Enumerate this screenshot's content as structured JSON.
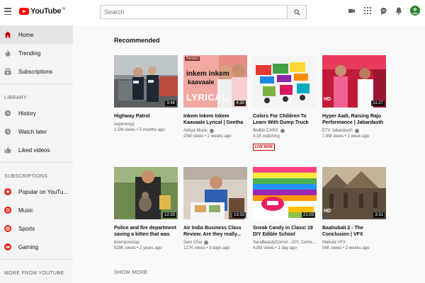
{
  "header": {
    "logo_text": "YouTube",
    "logo_sup": "IN",
    "search_placeholder": "Search"
  },
  "sidebar": {
    "main_items": [
      {
        "label": "Home",
        "icon": "home-icon"
      },
      {
        "label": "Trending",
        "icon": "flame-icon"
      },
      {
        "label": "Subscriptions",
        "icon": "subscriptions-icon"
      }
    ],
    "library_title": "LIBRARY",
    "library_items": [
      {
        "label": "History",
        "icon": "history-icon"
      },
      {
        "label": "Watch later",
        "icon": "clock-icon"
      },
      {
        "label": "Liked videos",
        "icon": "thumbs-up-icon"
      }
    ],
    "subscriptions_title": "SUBSCRIPTIONS",
    "subscription_items": [
      {
        "label": "Popular on YouTu...",
        "icon": "star-channel-icon"
      },
      {
        "label": "Music",
        "icon": "music-channel-icon"
      },
      {
        "label": "Sports",
        "icon": "sports-channel-icon"
      },
      {
        "label": "Gaming",
        "icon": "gaming-channel-icon"
      }
    ],
    "more_title": "MORE FROM YOUTUBE"
  },
  "main": {
    "section_title": "Recommended",
    "show_more": "SHOW MORE",
    "videos": [
      {
        "title": "Highway Patrol",
        "channel": "superwog1",
        "verified": true,
        "meta": "1.5M views • 5 months ago",
        "duration": "3:48",
        "live": ""
      },
      {
        "title": "Inkem Inkem Inkem Kaavaale Lyrical | Geetha Govindam...",
        "channel": "Aditya Music",
        "verified": true,
        "meta": "25M views • 2 weeks ago",
        "duration": "4:30",
        "live": ""
      },
      {
        "title": "Colors For Children To Learn With Dump Truck Toys #w -...",
        "channel": "BinBin CARS",
        "verified": true,
        "meta": "4.1K watching",
        "duration": "",
        "live": "LIVE NOW"
      },
      {
        "title": "Hyper Aadi, Raising Raju Performance | Jabardasth |...",
        "channel": "ETV Jabardasth",
        "verified": true,
        "meta": "7.8M views • 1 week ago",
        "duration": "11:27",
        "live": ""
      },
      {
        "title": "Police and fire department saving a kitten that was stu...",
        "channel": "boompowzap",
        "verified": false,
        "meta": "529K views • 2 years ago",
        "duration": "12:33",
        "live": ""
      },
      {
        "title": "Air India Business Class Review. Are they really...",
        "channel": "Sam Chui",
        "verified": true,
        "meta": "127K views • 3 days ago",
        "duration": "13:33",
        "live": ""
      },
      {
        "title": "Sneak Candy in Class! 19 DIY Edible School Supplies &...",
        "channel": "SaraBeautyCorner - DIY, Come...",
        "verified": false,
        "meta": "4.8M views • 1 day ago",
        "duration": "21:03",
        "live": ""
      },
      {
        "title": "Baahubali 2 - The Conclusion | VFX Breakdowns",
        "channel": "Makuta VFX",
        "verified": false,
        "meta": "54K views • 2 weeks ago",
        "duration": "3:31",
        "live": ""
      }
    ],
    "thumbnail_text": {
      "1": {
        "tag1": "Ramjoo",
        "tag2": "inkem inkem",
        "tag3": "kaavaale",
        "tag4": "LYRICAL"
      },
      "3": {
        "tag": "HD"
      },
      "4": {
        "tag": "HD"
      }
    }
  },
  "colors": {
    "brand_red": "#ff0000",
    "live_red": "#cc0000",
    "sidebar_bg": "#f5f5f5",
    "active_bg": "#e5e5e5"
  }
}
